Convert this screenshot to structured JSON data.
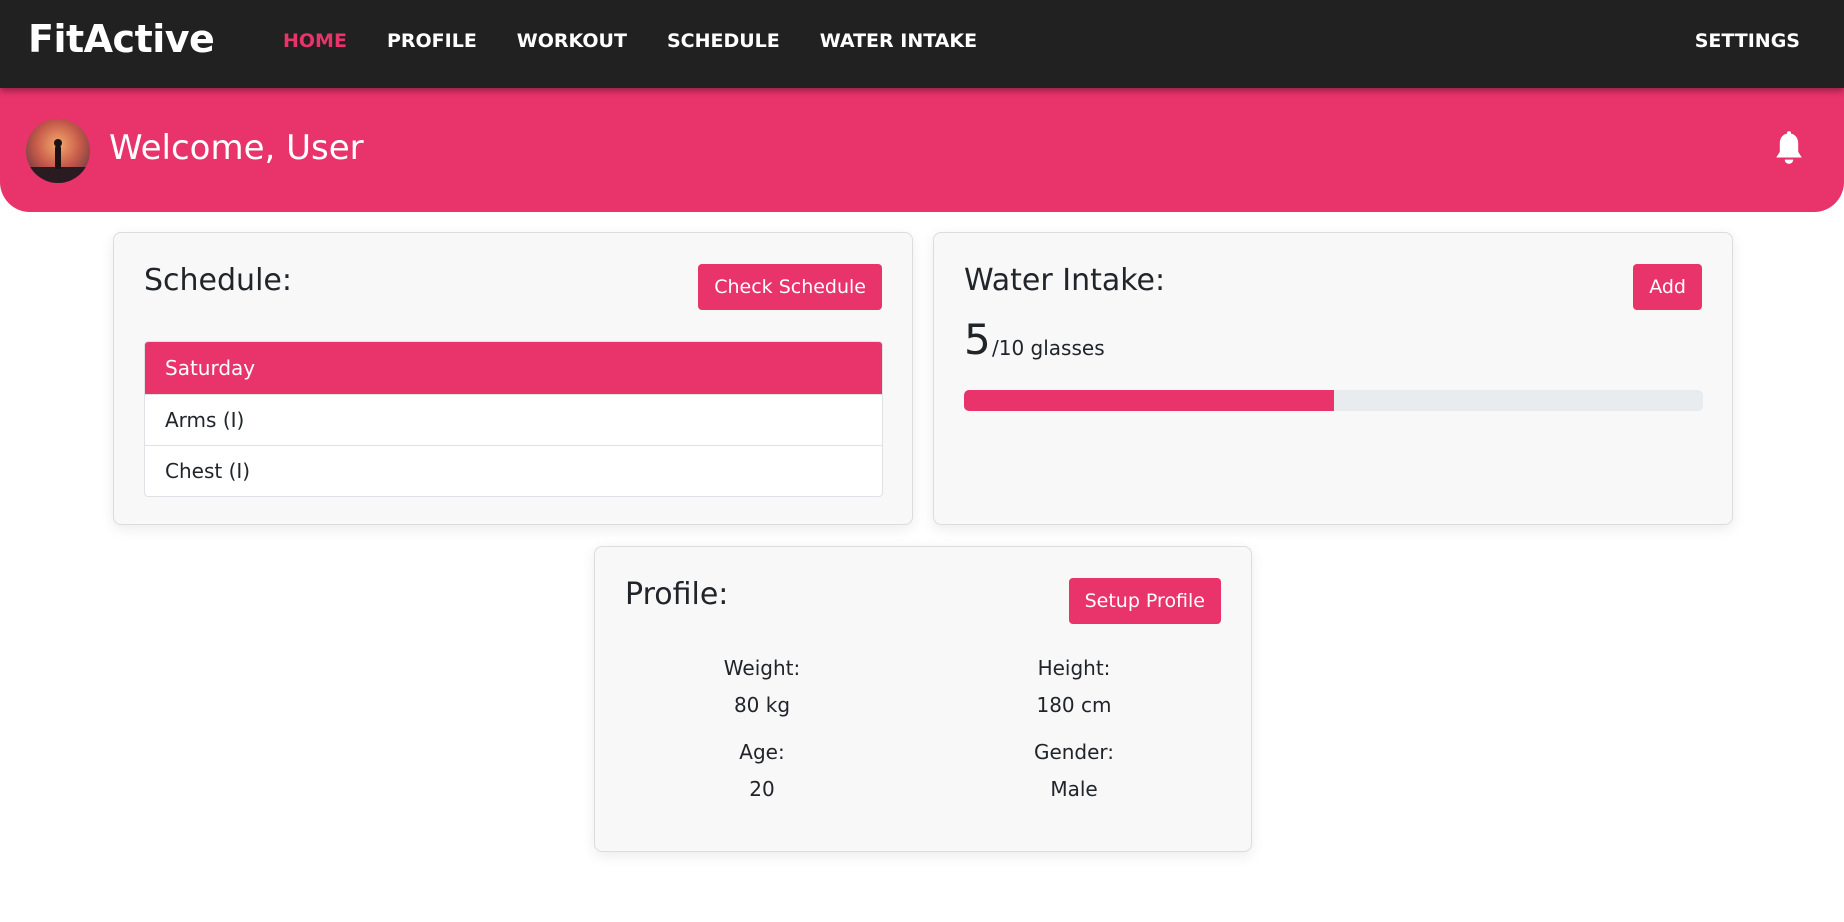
{
  "nav": {
    "brand": "FitActive",
    "links": [
      {
        "label": "HOME",
        "active": true
      },
      {
        "label": "PROFILE",
        "active": false
      },
      {
        "label": "WORKOUT",
        "active": false
      },
      {
        "label": "SCHEDULE",
        "active": false
      },
      {
        "label": "WATER INTAKE",
        "active": false
      }
    ],
    "settings": "SETTINGS"
  },
  "banner": {
    "welcome": "Welcome, User",
    "icons": {
      "avatar": "user-avatar",
      "notification": "bell-icon"
    }
  },
  "schedule": {
    "title": "Schedule:",
    "button": "Check Schedule",
    "day": "Saturday",
    "items": [
      "Arms (I)",
      "Chest (I)"
    ]
  },
  "water": {
    "title": "Water Intake:",
    "button": "Add",
    "current": "5",
    "total_label": "/10 glasses",
    "progress_fraction": 0.5
  },
  "profile": {
    "title": "Profile:",
    "button": "Setup Profile",
    "weight_label": "Weight:",
    "weight_value": "80 kg",
    "height_label": "Height:",
    "height_value": "180 cm",
    "age_label": "Age:",
    "age_value": "20",
    "gender_label": "Gender:",
    "gender_value": "Male"
  },
  "colors": {
    "accent": "#e8336b",
    "navbar": "#212121"
  }
}
